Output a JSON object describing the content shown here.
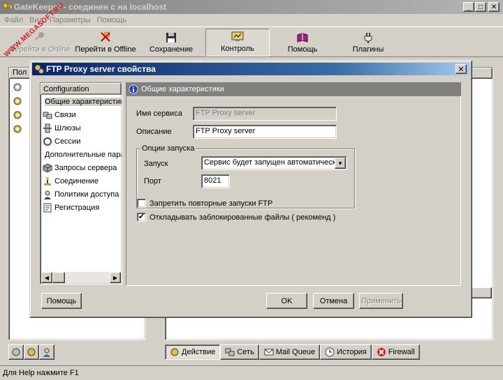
{
  "window": {
    "title": "GateKeeper - соединен с на localhost"
  },
  "watermark": "WWW.MEGASOFT.RU",
  "menu": [
    "Файл",
    "Вид",
    "Параметры",
    "Помощь"
  ],
  "toolbar": {
    "go_online": "Перейти в Online",
    "go_offline": "Перейти в Offline",
    "save": "Сохранение",
    "control": "Контроль",
    "help": "Помощь",
    "plugins": "Плагины"
  },
  "left_panel": {
    "header": "Пол"
  },
  "bottom_tabs": [
    "Действие",
    "Сеть",
    "Mail Queue",
    "История",
    "Firewall"
  ],
  "status": "Для Help нажмите F1",
  "dialog": {
    "title": "FTP Proxy server свойства",
    "nav_header": "Configuration",
    "nav_items": [
      "Общие характеристики",
      "Связи",
      "Шлюзы",
      "Сессии",
      "Дополнительные параметры",
      "Запросы сервера",
      "Соединение",
      "Политики доступа",
      "Регистрация"
    ],
    "section_title": "Общие характеристики",
    "service_name_label": "Имя сервиса",
    "service_name_value": "FTP Proxy server",
    "description_label": "Описание",
    "description_value": "FTP Proxy server",
    "launch_group": "Опции запуска",
    "launch_label": "Запуск",
    "launch_value": "Сервис будет запущен автоматически",
    "port_label": "Порт",
    "port_value": "8021",
    "check1": {
      "label": "Запретить повторные запуски FTP",
      "checked": false
    },
    "check2": {
      "label": "Откладывать заблокированные файлы ( рекоменд )",
      "checked": true
    },
    "help_btn": "Помощь",
    "ok_btn": "OK",
    "cancel_btn": "Отмена",
    "apply_btn": "Применить"
  }
}
